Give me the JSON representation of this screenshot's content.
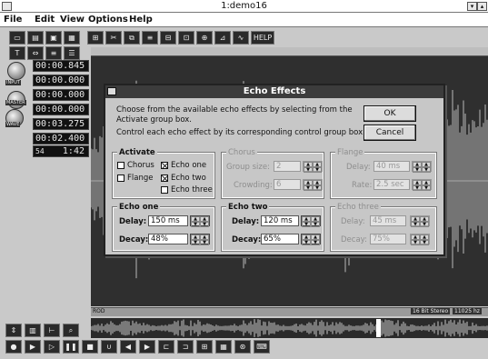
{
  "app": {
    "title": "1:demo16",
    "menu": [
      "File",
      "Edit",
      "View",
      "Options",
      "Help"
    ]
  },
  "toolbar": {
    "help_label": "HELP"
  },
  "transport": {
    "knob_labels": [
      "INPUT",
      "MASTER",
      "WAVE"
    ],
    "times": [
      "00:00.845",
      "00:00.000",
      "00:00.000",
      "00:00.000",
      "00:03.275",
      "00:02.400",
      "1:42"
    ],
    "time_prefix": "54"
  },
  "status": {
    "left_tag": "ROD",
    "format": "16 Bit Stereo",
    "rate": "11025 hz"
  },
  "dialog": {
    "title": "Echo Effects",
    "instructions": [
      "Choose from the available echo effects by selecting from the",
      "Activate group box.",
      "Control each echo effect by its corresponding control group box"
    ],
    "ok_label": "OK",
    "cancel_label": "Cancel",
    "activate": {
      "label": "Activate",
      "options": [
        {
          "label": "Chorus",
          "checked": false
        },
        {
          "label": "Flange",
          "checked": false
        },
        {
          "label": "Echo one",
          "checked": true
        },
        {
          "label": "Echo two",
          "checked": true
        },
        {
          "label": "Echo three",
          "checked": false
        }
      ]
    },
    "chorus": {
      "label": "Chorus",
      "group_size_label": "Group size:",
      "group_size": "2",
      "crowding_label": "Crowding:",
      "crowding": "6"
    },
    "flange": {
      "label": "Flange",
      "delay_label": "Delay:",
      "delay": "40 ms",
      "rate_label": "Rate:",
      "rate": "2.5 sec"
    },
    "echo_one": {
      "label": "Echo one",
      "delay_label": "Delay:",
      "delay": "150 ms",
      "decay_label": "Decay:",
      "decay": "48%"
    },
    "echo_two": {
      "label": "Echo two",
      "delay_label": "Delay:",
      "delay": "120 ms",
      "decay_label": "Decay:",
      "decay": "65%"
    },
    "echo_three": {
      "label": "Echo three",
      "delay_label": "Delay:",
      "delay": "45 ms",
      "decay_label": "Decay:",
      "decay": "75%"
    }
  }
}
